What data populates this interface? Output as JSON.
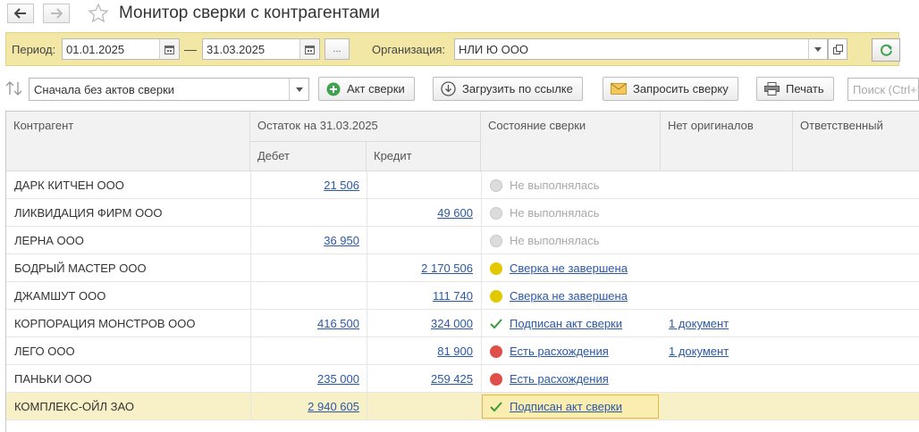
{
  "window": {
    "title": "Монитор сверки с контрагентами"
  },
  "filters": {
    "period_label": "Период:",
    "date_from": "01.01.2025",
    "dash": "—",
    "date_to": "31.03.2025",
    "more_label": "...",
    "org_label": "Организация:",
    "org_value": "НЛИ Ю ООО"
  },
  "toolbar": {
    "sort_value": "Сначала без актов сверки",
    "act_label": "Акт сверки",
    "load_label": "Загрузить по ссылке",
    "request_label": "Запросить сверку",
    "print_label": "Печать",
    "search_placeholder": "Поиск (Ctrl+F)"
  },
  "table": {
    "headers": {
      "counterparty": "Контрагент",
      "balance": "Остаток на 31.03.2025",
      "debit": "Дебет",
      "credit": "Кредит",
      "status": "Состояние сверки",
      "no_originals": "Нет оригиналов",
      "responsible": "Ответственный"
    },
    "rows": [
      {
        "name": "ДАРК КИТЧЕН ООО",
        "debit": "21 506",
        "credit": "",
        "status": "Не выполнялась",
        "status_kind": "gray",
        "originals": ""
      },
      {
        "name": "ЛИКВИДАЦИЯ ФИРМ ООО",
        "debit": "",
        "credit": "49 600",
        "status": "Не выполнялась",
        "status_kind": "gray",
        "originals": ""
      },
      {
        "name": "ЛЕРНА ООО",
        "debit": "36 950",
        "credit": "",
        "status": "Не выполнялась",
        "status_kind": "gray",
        "originals": ""
      },
      {
        "name": "БОДРЫЙ МАСТЕР ООО",
        "debit": "",
        "credit": "2 170 506",
        "status": "Сверка не завершена",
        "status_kind": "yellow",
        "originals": ""
      },
      {
        "name": "ДЖАМШУТ ООО",
        "debit": "",
        "credit": "111 740",
        "status": "Сверка не завершена",
        "status_kind": "yellow",
        "originals": ""
      },
      {
        "name": "КОРПОРАЦИЯ МОНСТРОВ ООО",
        "debit": "416 500",
        "credit": "324 000",
        "status": "Подписан акт сверки",
        "status_kind": "check",
        "originals": "1 документ"
      },
      {
        "name": "ЛЕГО ООО",
        "debit": "",
        "credit": "81 900",
        "status": "Есть расхождения",
        "status_kind": "red",
        "originals": "1 документ"
      },
      {
        "name": "ПАНЬКИ ООО",
        "debit": "235 000",
        "credit": "259 425",
        "status": "Есть расхождения",
        "status_kind": "red",
        "originals": ""
      },
      {
        "name": "КОМПЛЕКС-ОЙЛ ЗАО",
        "debit": "2 940 605",
        "credit": "",
        "status": "Подписан акт сверки",
        "status_kind": "check",
        "originals": "",
        "selected": true
      }
    ]
  },
  "colors": {
    "accent_yellow": "#f3e7a5",
    "link": "#2b58a5",
    "dot_gray": "#dcdcdc",
    "dot_yellow": "#e3c800",
    "dot_red": "#e0504a",
    "check_green": "#3a9a3a",
    "add_green": "#3fa34d"
  },
  "icons": {
    "back": "arrow-left-icon",
    "forward": "arrow-right-icon",
    "favorite": "star-icon",
    "calendar": "calendar-icon",
    "open": "open-form-icon",
    "refresh": "refresh-icon",
    "sort": "sort-icon",
    "add": "plus-circle-icon",
    "load": "download-link-icon",
    "request": "envelope-icon",
    "print": "printer-icon"
  }
}
